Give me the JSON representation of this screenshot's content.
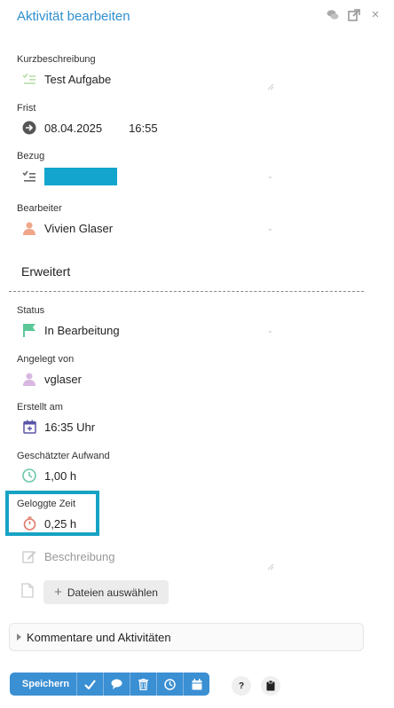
{
  "header": {
    "title": "Aktivität bearbeiten",
    "icons": [
      "chat-icon",
      "external-link-icon",
      "close-icon"
    ],
    "close_glyph": "×"
  },
  "fields": {
    "kurzbeschreibung": {
      "label": "Kurzbeschreibung",
      "value": "Test Aufgabe"
    },
    "frist": {
      "label": "Frist",
      "date": "08.04.2025",
      "time": "16:55"
    },
    "bezug": {
      "label": "Bezug",
      "value": ""
    },
    "bearbeiter": {
      "label": "Bearbeiter",
      "value": "Vivien Glaser"
    },
    "status": {
      "label": "Status",
      "value": "In Bearbeitung"
    },
    "angelegt_von": {
      "label": "Angelegt von",
      "value": "vglaser"
    },
    "erstellt_am": {
      "label": "Erstellt am",
      "value": "16:35 Uhr"
    },
    "geschaetzter_aufwand": {
      "label": "Geschätzter Aufwand",
      "value": "1,00 h"
    },
    "geloggte_zeit": {
      "label": "Geloggte Zeit",
      "value": "0,25 h"
    },
    "beschreibung": {
      "placeholder": "Beschreibung"
    }
  },
  "section": {
    "erweitert": "Erweitert"
  },
  "files": {
    "button_label": "Dateien auswählen",
    "plus": "+"
  },
  "comments": {
    "label": "Kommentare und Aktivitäten"
  },
  "toolbar": {
    "save_label": "Speichern",
    "help": "?"
  },
  "colors": {
    "accent": "#3b8fd3",
    "title": "#2f8fd0",
    "highlight": "#17a3c4",
    "bezug_chip": "#14a5cf",
    "status_flag": "#5cc89a"
  }
}
